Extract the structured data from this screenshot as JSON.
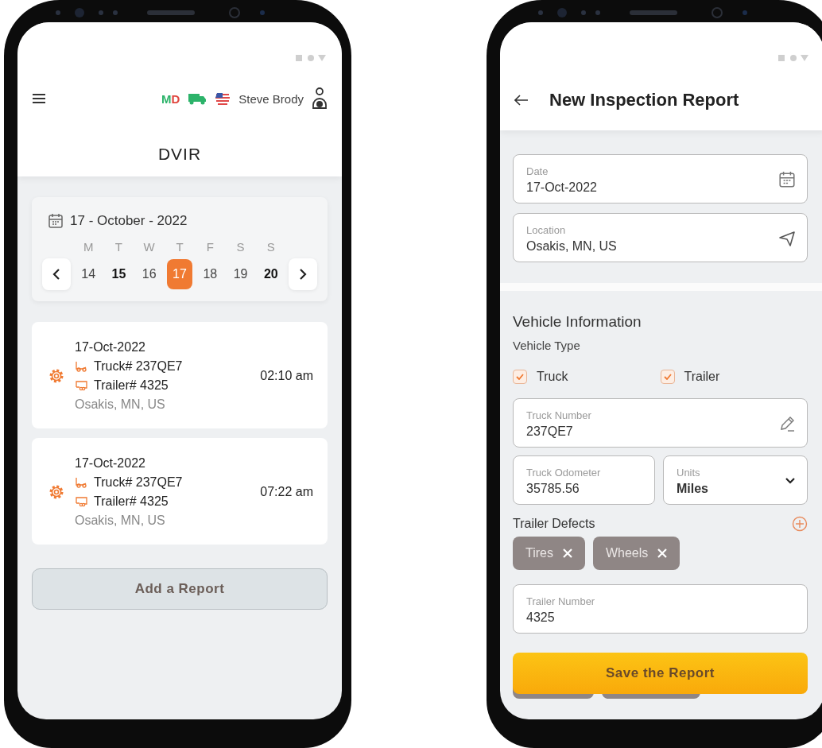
{
  "left_screen": {
    "header": {
      "badge": "MD",
      "driver_name": "Steve Brody",
      "title": "DVIR"
    },
    "calendar": {
      "date_label": "17 - October - 2022",
      "weekdays": [
        "M",
        "T",
        "W",
        "T",
        "F",
        "S",
        "S"
      ],
      "days": [
        {
          "label": "14",
          "selected": false,
          "highlighted": false
        },
        {
          "label": "15",
          "selected": false,
          "highlighted": true
        },
        {
          "label": "16",
          "selected": false,
          "highlighted": false
        },
        {
          "label": "17",
          "selected": true,
          "highlighted": false
        },
        {
          "label": "18",
          "selected": false,
          "highlighted": false
        },
        {
          "label": "19",
          "selected": false,
          "highlighted": false
        },
        {
          "label": "20",
          "selected": false,
          "highlighted": true
        }
      ]
    },
    "reports": [
      {
        "date": "17-Oct-2022",
        "truck": "Truck# 237QE7",
        "trailer": "Trailer# 4325",
        "location": "Osakis, MN, US",
        "time": "02:10 am"
      },
      {
        "date": "17-Oct-2022",
        "truck": "Truck# 237QE7",
        "trailer": "Trailer# 4325",
        "location": "Osakis, MN, US",
        "time": "07:22 am"
      }
    ],
    "add_button": "Add a Report"
  },
  "right_screen": {
    "title": "New Inspection Report",
    "date_field": {
      "label": "Date",
      "value": "17-Oct-2022"
    },
    "location_field": {
      "label": "Location",
      "value": "Osakis, MN, US"
    },
    "section_title": "Vehicle Information",
    "vehicle_type_label": "Vehicle Type",
    "vehicle_types": [
      {
        "label": "Truck",
        "checked": true
      },
      {
        "label": "Trailer",
        "checked": true
      }
    ],
    "truck_number": {
      "label": "Truck Number",
      "value": "237QE7"
    },
    "truck_odometer": {
      "label": "Truck Odometer",
      "value": "35785.56"
    },
    "units": {
      "label": "Units",
      "value": "Miles"
    },
    "defects_after_truck": {
      "label": "Trailer Defects",
      "chips": [
        "Tires",
        "Wheels"
      ]
    },
    "trailer_number": {
      "label": "Trailer Number",
      "value": "4325"
    },
    "save_button": "Save the Report"
  }
}
